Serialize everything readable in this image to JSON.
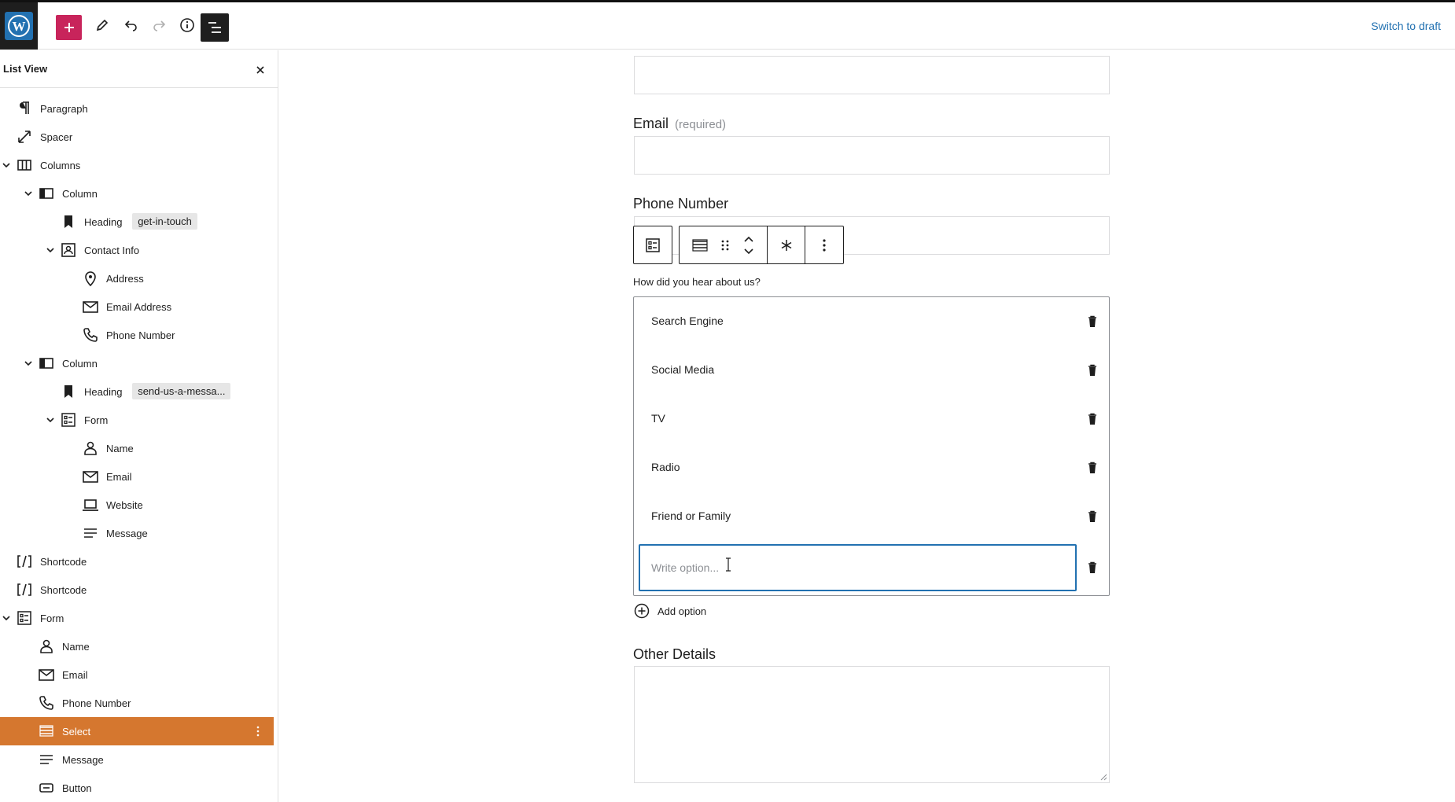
{
  "topbar": {
    "switch_to_draft": "Switch to draft"
  },
  "sidebar": {
    "title": "List View",
    "items": [
      {
        "label": "Paragraph",
        "icon": "paragraph-icon"
      },
      {
        "label": "Spacer",
        "icon": "spacer-icon"
      },
      {
        "label": "Columns",
        "icon": "columns-icon",
        "expanded": true
      },
      {
        "label": "Column",
        "icon": "column-icon",
        "expanded": true
      },
      {
        "label": "Heading",
        "icon": "bookmark-icon",
        "tag": "get-in-touch"
      },
      {
        "label": "Contact Info",
        "icon": "contact-info-icon",
        "expanded": true
      },
      {
        "label": "Address",
        "icon": "map-pin-icon"
      },
      {
        "label": "Email Address",
        "icon": "envelope-icon"
      },
      {
        "label": "Phone Number",
        "icon": "phone-icon"
      },
      {
        "label": "Column",
        "icon": "column-icon",
        "expanded": true
      },
      {
        "label": "Heading",
        "icon": "bookmark-icon",
        "tag": "send-us-a-messa..."
      },
      {
        "label": "Form",
        "icon": "form-icon",
        "expanded": true
      },
      {
        "label": "Name",
        "icon": "person-icon"
      },
      {
        "label": "Email",
        "icon": "envelope-icon"
      },
      {
        "label": "Website",
        "icon": "laptop-icon"
      },
      {
        "label": "Message",
        "icon": "message-lines-icon"
      },
      {
        "label": "Shortcode",
        "icon": "shortcode-icon"
      },
      {
        "label": "Shortcode",
        "icon": "shortcode-icon"
      },
      {
        "label": "Form",
        "icon": "form-icon",
        "expanded": true
      },
      {
        "label": "Name",
        "icon": "person-icon"
      },
      {
        "label": "Email",
        "icon": "envelope-icon"
      },
      {
        "label": "Phone Number",
        "icon": "phone-icon"
      },
      {
        "label": "Select",
        "icon": "select-icon",
        "selected": true
      },
      {
        "label": "Message",
        "icon": "message-lines-icon"
      },
      {
        "label": "Button",
        "icon": "button-icon"
      }
    ]
  },
  "form": {
    "email_label": "Email",
    "email_required": "(required)",
    "phone_label": "Phone Number",
    "select_label": "How did you hear about us?",
    "options": [
      "Search Engine",
      "Social Media",
      "TV",
      "Radio",
      "Friend or Family"
    ],
    "new_option_placeholder": "Write option...",
    "add_option": "Add option",
    "other_details_label": "Other Details"
  },
  "colors": {
    "selected_row": "#d5772f",
    "add_button": "#c8245b",
    "focus_blue": "#2271b1"
  }
}
